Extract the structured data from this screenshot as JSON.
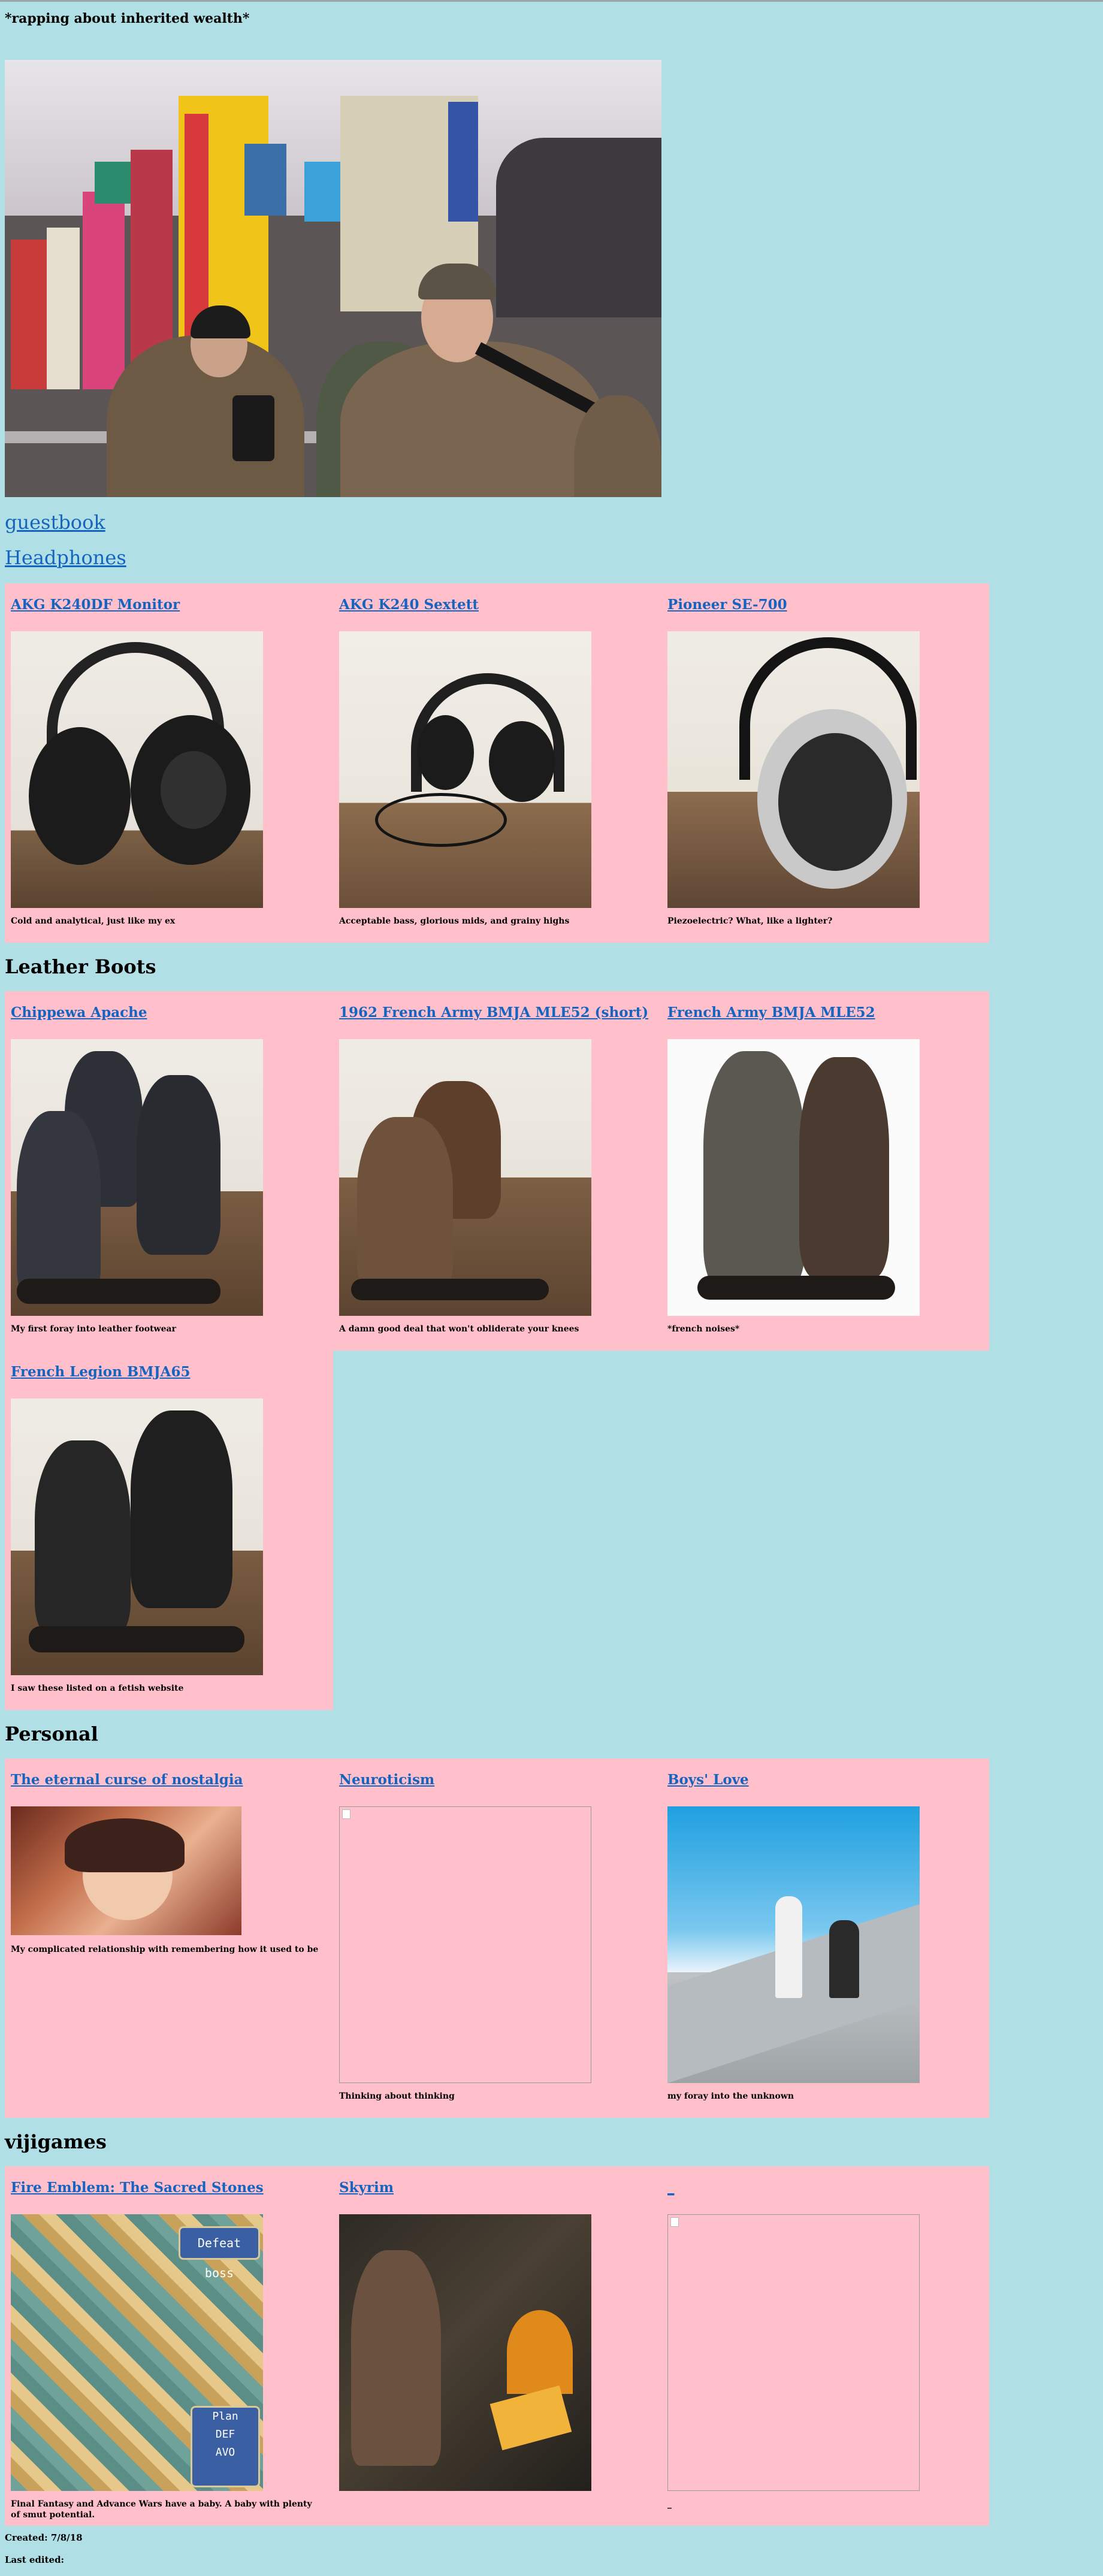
{
  "tagline": "*rapping about inherited wealth*",
  "nav": {
    "guestbook": "guestbook",
    "headphones": "Headphones"
  },
  "sections": {
    "headphones": {
      "items": [
        {
          "title": "AKG K240DF Monitor",
          "caption": "Cold and analytical, just like my ex"
        },
        {
          "title": "AKG K240 Sextett",
          "caption": "Acceptable bass, glorious mids, and grainy highs"
        },
        {
          "title": "Pioneer SE-700",
          "caption": "Piezoelectric? What, like a lighter?"
        }
      ]
    },
    "leather_boots": {
      "heading": "Leather Boots",
      "items": [
        {
          "title": "Chippewa Apache",
          "caption": "My first foray into leather footwear"
        },
        {
          "title": "1962 French Army BMJA MLE52 (short)",
          "caption": "A damn good deal that won't obliderate your knees"
        },
        {
          "title": "French Army BMJA MLE52",
          "caption": "*french noises*"
        },
        {
          "title": "French Legion BMJA65",
          "caption": "I saw these listed on a fetish website"
        }
      ]
    },
    "personal": {
      "heading": "Personal",
      "items": [
        {
          "title": "The eternal curse of nostalgia",
          "caption": "My complicated relationship with remembering how it used to be"
        },
        {
          "title": "Neuroticism",
          "caption": "Thinking about thinking"
        },
        {
          "title": "Boys' Love",
          "caption": "my foray into the unknown"
        }
      ]
    },
    "vijigames": {
      "heading": "vijigames",
      "items": [
        {
          "title": "Fire Emblem: The Sacred Stones",
          "caption": "Final Fantasy and Advance Wars have a baby. A baby with plenty of smut potential."
        },
        {
          "title": "Skyrim",
          "caption": ""
        },
        {
          "title": "_",
          "caption": "_"
        }
      ]
    }
  },
  "footer": {
    "created": "Created: 7/8/18",
    "last_edited": "Last edited:"
  },
  "game_ui": {
    "defeat_boss": "Defeat boss",
    "plan": "Plan",
    "def": "DEF",
    "avo": "AVO"
  },
  "colors": {
    "page_background": "#b0e0e6",
    "panel_background": "#ffc0cb",
    "link": "#1565c0"
  }
}
